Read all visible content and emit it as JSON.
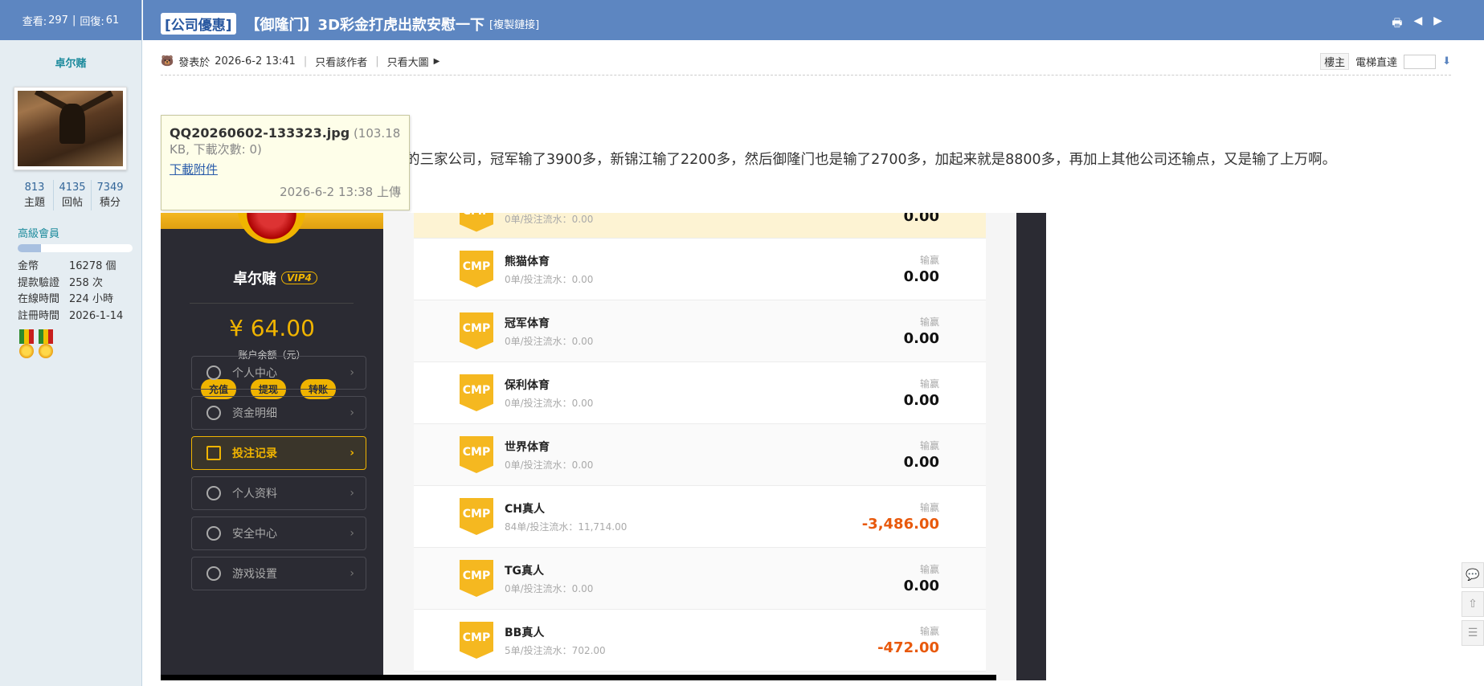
{
  "sidebar": {
    "stats_views_label": "查看:",
    "stats_views": "297",
    "stats_sep": "|",
    "stats_replies_label": "回復:",
    "stats_replies": "61",
    "username": "卓尔赌",
    "counts": [
      {
        "num": "813",
        "label": "主題"
      },
      {
        "num": "4135",
        "label": "回帖"
      },
      {
        "num": "7349",
        "label": "積分"
      }
    ],
    "group": "高級會員",
    "level_progress": 0.2,
    "info": [
      {
        "key": "金幣",
        "value": "16278 個"
      },
      {
        "key": "提款驗證",
        "value": "258 次"
      },
      {
        "key": "在線時間",
        "value": "224 小時"
      },
      {
        "key": "註冊時間",
        "value": "2026-1-14"
      }
    ]
  },
  "header": {
    "tag": "[公司優惠]",
    "title": "【御隆门】3D彩金打虎出款安慰一下",
    "copy_link": "[複製鏈接]",
    "icons": [
      "print-icon",
      "prev-icon",
      "next-icon"
    ]
  },
  "meta": {
    "posted_label": "發表於",
    "posted_time": "2026-6-2 13:41",
    "only_author": "只看該作者",
    "only_images": "只看大圖",
    "floor": "樓主",
    "elevator": "電梯直達"
  },
  "post_text": "的三家公司，冠军输了3900多，新锦江输了2200多，然后御隆门也是输了2700多，加起来就是8800多，再加上其他公司还输点，又是输了上万啊。",
  "tooltip": {
    "filename": "QQ20260602-133323.jpg",
    "size_info": " (103.18 KB, 下載次數: 0)",
    "download": "下載附件",
    "uploaded": "2026-6-2 13:38 上傳"
  },
  "app": {
    "username": "卓尔赌",
    "vip": "VIP4",
    "balance": "¥ 64.00",
    "balance_label": "账户余额（元）",
    "actions": [
      "充值",
      "提现",
      "转账"
    ],
    "menu": [
      {
        "label": "个人中心",
        "active": false
      },
      {
        "label": "资金明细",
        "active": false
      },
      {
        "label": "投注记录",
        "active": true
      },
      {
        "label": "个人资料",
        "active": false
      },
      {
        "label": "安全中心",
        "active": false
      },
      {
        "label": "游戏设置",
        "active": false
      }
    ],
    "win_label": "输赢",
    "cmp_logo": "CMP",
    "items": [
      {
        "name": "",
        "sub": "0单/投注流水：0.00",
        "value": "0.00",
        "neg": false,
        "hl": true
      },
      {
        "name": "熊猫体育",
        "sub": "0单/投注流水：0.00",
        "value": "0.00",
        "neg": false,
        "hl": false
      },
      {
        "name": "冠军体育",
        "sub": "0单/投注流水：0.00",
        "value": "0.00",
        "neg": false,
        "hl": false
      },
      {
        "name": "保利体育",
        "sub": "0单/投注流水：0.00",
        "value": "0.00",
        "neg": false,
        "hl": false
      },
      {
        "name": "世界体育",
        "sub": "0单/投注流水：0.00",
        "value": "0.00",
        "neg": false,
        "hl": false
      },
      {
        "name": "CH真人",
        "sub": "84单/投注流水：11,714.00",
        "value": "-3,486.00",
        "neg": true,
        "hl": false
      },
      {
        "name": "TG真人",
        "sub": "0单/投注流水：0.00",
        "value": "0.00",
        "neg": false,
        "hl": false
      },
      {
        "name": "BB真人",
        "sub": "5单/投注流水：702.00",
        "value": "-472.00",
        "neg": true,
        "hl": false
      }
    ]
  }
}
